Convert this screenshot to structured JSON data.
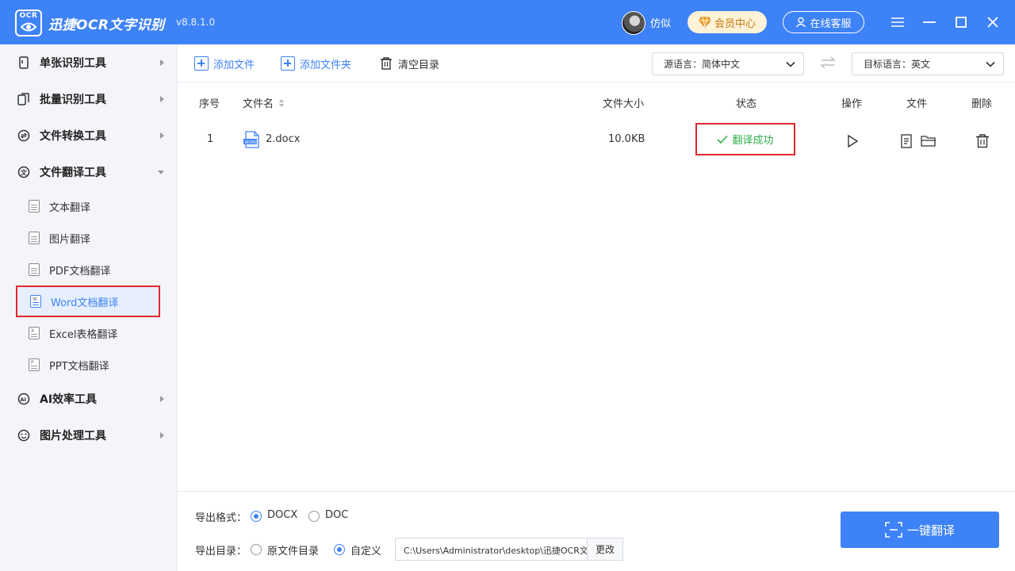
{
  "app": {
    "logo_text": "OCR",
    "title": "迅捷OCR文字识别",
    "version": "v8.8.1.0",
    "username": "仿似",
    "vip_label": "会员中心",
    "service_label": "在线客服"
  },
  "sidebar": {
    "categories": [
      {
        "label": "单张识别工具"
      },
      {
        "label": "批量识别工具"
      },
      {
        "label": "文件转换工具"
      },
      {
        "label": "文件翻译工具"
      },
      {
        "label": "AI效率工具"
      },
      {
        "label": "图片处理工具"
      }
    ],
    "translate_items": [
      {
        "label": "文本翻译"
      },
      {
        "label": "图片翻译"
      },
      {
        "label": "PDF文档翻译"
      },
      {
        "label": "Word文档翻译"
      },
      {
        "label": "Excel表格翻译"
      },
      {
        "label": "PPT文档翻译"
      }
    ]
  },
  "toolbar": {
    "add_file": "添加文件",
    "add_folder": "添加文件夹",
    "clear_list": "清空目录",
    "source_lang": "源语言：简体中文",
    "target_lang": "目标语言：英文"
  },
  "table": {
    "headers": {
      "index": "序号",
      "filename": "文件名",
      "size": "文件大小",
      "status": "状态",
      "operation": "操作",
      "file": "文件",
      "delete": "删除"
    },
    "rows": [
      {
        "index": "1",
        "filename": "2.docx",
        "size": "10.0KB",
        "status": "翻译成功"
      }
    ]
  },
  "bottom": {
    "format_label": "导出格式：",
    "format_docx": "DOCX",
    "format_doc": "DOC",
    "dir_label": "导出目录：",
    "dir_original": "原文件目录",
    "dir_custom": "自定义",
    "path": "C:\\Users\\Administrator\\desktop\\迅捷OCR文",
    "change_label": "更改",
    "translate_label": "一键翻译"
  },
  "colors": {
    "accent": "#3e82f7",
    "success": "#2fae4c",
    "highlight_border": "#e0282e"
  }
}
